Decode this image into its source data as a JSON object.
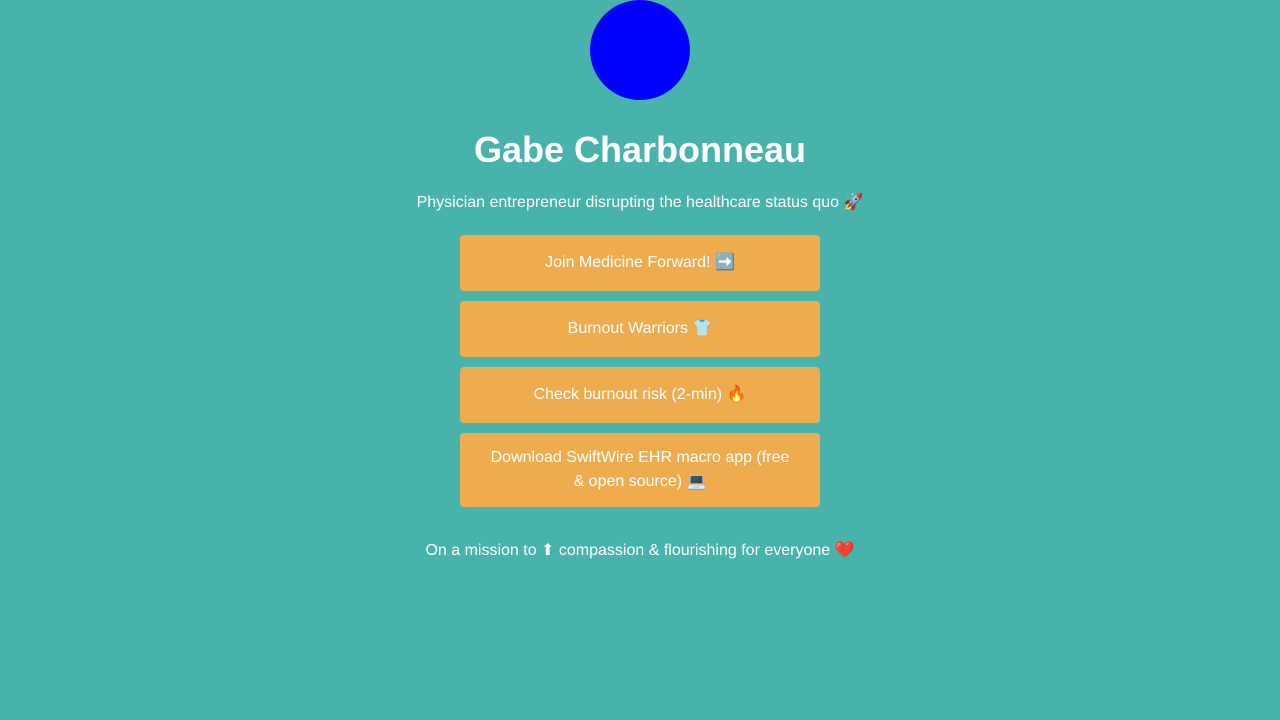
{
  "profile": {
    "avatar_color": "#0000ff",
    "name": "Gabe Charbonneau",
    "bio": "Physician entrepreneur disrupting the healthcare status quo 🚀"
  },
  "links": [
    {
      "label": "Join Medicine Forward! ➡️"
    },
    {
      "label": "Burnout Warriors 👕"
    },
    {
      "label": "Check burnout risk (2-min) 🔥"
    },
    {
      "label": "Download SwiftWire EHR macro app (free & open source) 💻"
    }
  ],
  "footer": {
    "text": "On a mission to ⬆ compassion & flourishing for everyone ❤️"
  },
  "colors": {
    "background": "#47b3aa",
    "button": "#efac4f",
    "text": "#ffffff"
  }
}
